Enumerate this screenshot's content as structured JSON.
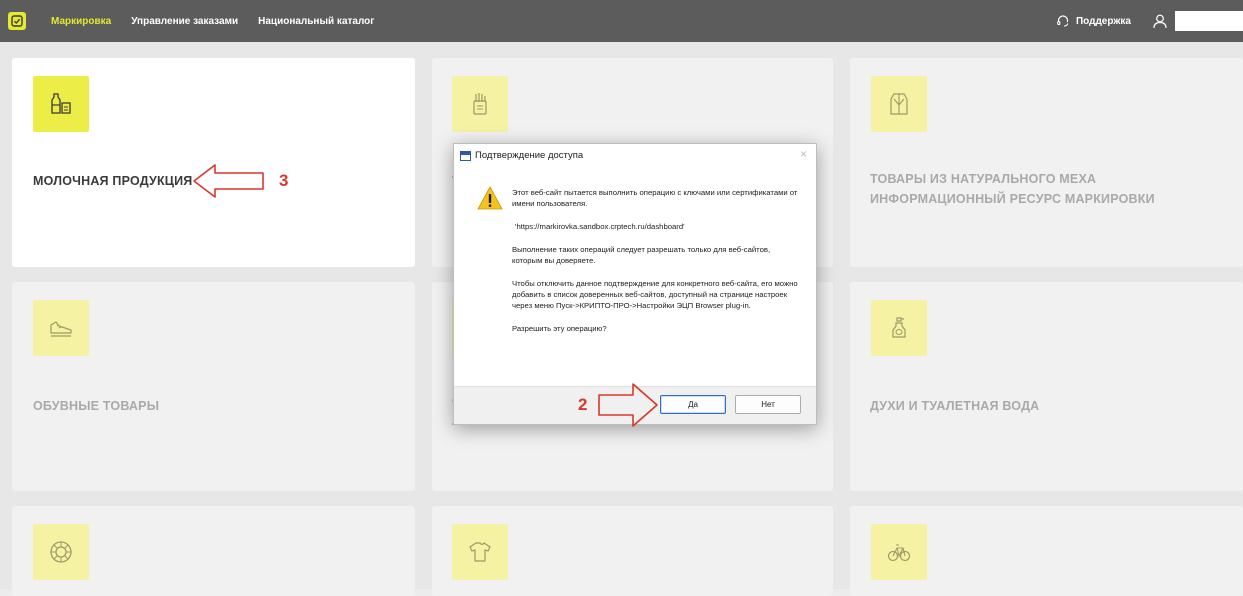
{
  "nav": {
    "logo_icon": "qr-check-icon",
    "items": [
      {
        "label": "Маркировка",
        "active": true
      },
      {
        "label": "Управление заказами",
        "active": false
      },
      {
        "label": "Национальный каталог",
        "active": false
      }
    ],
    "support_label": "Поддержка",
    "support_icon": "headset-icon",
    "user_icon": "user-icon"
  },
  "cards": [
    {
      "title": "МОЛОЧНАЯ ПРОДУКЦИЯ",
      "icon": "milk-bottle-icon"
    },
    {
      "title": "ТА",
      "icon": "hand-package-icon"
    },
    {
      "title": "ТОВАРЫ ИЗ НАТУРАЛЬНОГО МЕХА\nИНФОРМАЦИОННЫЙ РЕСУРС МАРКИРОВКИ",
      "icon": "fur-coat-icon"
    },
    {
      "title": "ОБУВНЫЕ ТОВАРЫ",
      "icon": "sneaker-icon"
    },
    {
      "title": "Ф\nЛ",
      "icon": "camera-icon"
    },
    {
      "title": "ДУХИ И ТУАЛЕТНАЯ ВОДА",
      "icon": "perfume-bottle-icon"
    },
    {
      "title": "",
      "icon": "tire-icon"
    },
    {
      "title": "",
      "icon": "tshirt-icon"
    },
    {
      "title": "",
      "icon": "bicycle-icon"
    }
  ],
  "annotations": {
    "arrow_3": "3",
    "arrow_2": "2"
  },
  "dialog": {
    "title": "Подтверждение доступа",
    "close": "×",
    "icon": "warning-icon",
    "paragraphs": [
      "Этот веб-сайт пытается выполнить операцию с ключами или сертификатами от имени пользователя.",
      "'https://markirovka.sandbox.crptech.ru/dashboard'",
      "Выполнение таких операций следует разрешать только для веб-сайтов, которым вы доверяете.",
      "Чтобы отключить данное подтверждение для конкретного веб-сайта, его можно добавить в список доверенных веб-сайтов, доступный на странице настроек через меню Пуск->КРИПТО-ПРО->Настройки ЭЦП Browser plug-in.",
      "Разрешить эту операцию?"
    ],
    "yes_label": "Да",
    "no_label": "Нет"
  },
  "colors": {
    "topbar": "#5c5c5c",
    "accent_yellow": "#e4e931",
    "annotation_red": "#d9372c",
    "button_focus_blue": "#2f6fc9"
  }
}
